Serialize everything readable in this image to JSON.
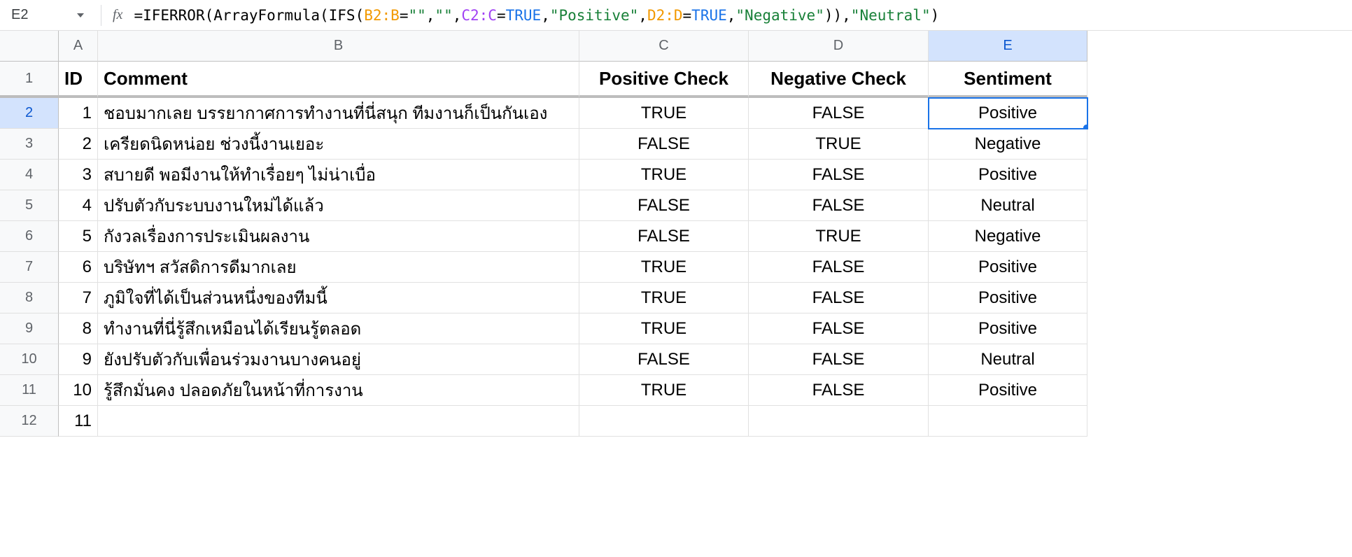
{
  "formula_bar": {
    "cell_ref": "E2",
    "fx_label": "fx",
    "tokens": [
      {
        "t": "=",
        "c": "tok-punct"
      },
      {
        "t": "IFERROR",
        "c": "tok-fn"
      },
      {
        "t": "(",
        "c": "tok-punct"
      },
      {
        "t": "ArrayFormula",
        "c": "tok-fn"
      },
      {
        "t": "(",
        "c": "tok-punct"
      },
      {
        "t": "IFS",
        "c": "tok-fn"
      },
      {
        "t": "(",
        "c": "tok-punct"
      },
      {
        "t": "B2:B",
        "c": "tok-orange"
      },
      {
        "t": "=",
        "c": "tok-punct"
      },
      {
        "t": "\"\"",
        "c": "tok-green"
      },
      {
        "t": ",",
        "c": "tok-punct"
      },
      {
        "t": "\"\"",
        "c": "tok-green"
      },
      {
        "t": ",",
        "c": "tok-punct"
      },
      {
        "t": "C2:C",
        "c": "tok-purple"
      },
      {
        "t": "=",
        "c": "tok-punct"
      },
      {
        "t": "TRUE",
        "c": "tok-blue"
      },
      {
        "t": ",",
        "c": "tok-punct"
      },
      {
        "t": "\"Positive\"",
        "c": "tok-green"
      },
      {
        "t": ",",
        "c": "tok-punct"
      },
      {
        "t": "D2:D",
        "c": "tok-orange"
      },
      {
        "t": "=",
        "c": "tok-punct"
      },
      {
        "t": "TRUE",
        "c": "tok-blue"
      },
      {
        "t": ",",
        "c": "tok-punct"
      },
      {
        "t": "\"Negative\"",
        "c": "tok-green"
      },
      {
        "t": "))",
        "c": "tok-punct"
      },
      {
        "t": ",",
        "c": "tok-punct"
      },
      {
        "t": "\"Neutral\"",
        "c": "tok-green"
      },
      {
        "t": ")",
        "c": "tok-punct"
      }
    ]
  },
  "columns": [
    "A",
    "B",
    "C",
    "D",
    "E"
  ],
  "selected_col": "E",
  "selected_row": "2",
  "headers": {
    "A": "ID",
    "B": "Comment",
    "C": "Positive Check",
    "D": "Negative Check",
    "E": "Sentiment"
  },
  "rows": [
    {
      "n": "2",
      "id": "1",
      "comment": "ชอบมากเลย บรรยากาศการทำงานที่นี่สนุก ทีมงานก็เป็นกันเอง",
      "pc": "TRUE",
      "nc": "FALSE",
      "s": "Positive"
    },
    {
      "n": "3",
      "id": "2",
      "comment": "เครียดนิดหน่อย ช่วงนี้งานเยอะ",
      "pc": "FALSE",
      "nc": "TRUE",
      "s": "Negative"
    },
    {
      "n": "4",
      "id": "3",
      "comment": "สบายดี พอมีงานให้ทำเรื่อยๆ ไม่น่าเบื่อ",
      "pc": "TRUE",
      "nc": "FALSE",
      "s": "Positive"
    },
    {
      "n": "5",
      "id": "4",
      "comment": "ปรับตัวกับระบบงานใหม่ได้แล้ว",
      "pc": "FALSE",
      "nc": "FALSE",
      "s": "Neutral"
    },
    {
      "n": "6",
      "id": "5",
      "comment": "กังวลเรื่องการประเมินผลงาน",
      "pc": "FALSE",
      "nc": "TRUE",
      "s": "Negative"
    },
    {
      "n": "7",
      "id": "6",
      "comment": "บริษัทฯ สวัสดิการดีมากเลย",
      "pc": "TRUE",
      "nc": "FALSE",
      "s": "Positive"
    },
    {
      "n": "8",
      "id": "7",
      "comment": "ภูมิใจที่ได้เป็นส่วนหนึ่งของทีมนี้",
      "pc": "TRUE",
      "nc": "FALSE",
      "s": "Positive"
    },
    {
      "n": "9",
      "id": "8",
      "comment": "ทำงานที่นี่รู้สึกเหมือนได้เรียนรู้ตลอด",
      "pc": "TRUE",
      "nc": "FALSE",
      "s": "Positive"
    },
    {
      "n": "10",
      "id": "9",
      "comment": "ยังปรับตัวกับเพื่อนร่วมงานบางคนอยู่",
      "pc": "FALSE",
      "nc": "FALSE",
      "s": "Neutral"
    },
    {
      "n": "11",
      "id": "10",
      "comment": "รู้สึกมั่นคง ปลอดภัยในหน้าที่การงาน",
      "pc": "TRUE",
      "nc": "FALSE",
      "s": "Positive"
    },
    {
      "n": "12",
      "id": "11",
      "comment": "",
      "pc": "",
      "nc": "",
      "s": ""
    }
  ]
}
